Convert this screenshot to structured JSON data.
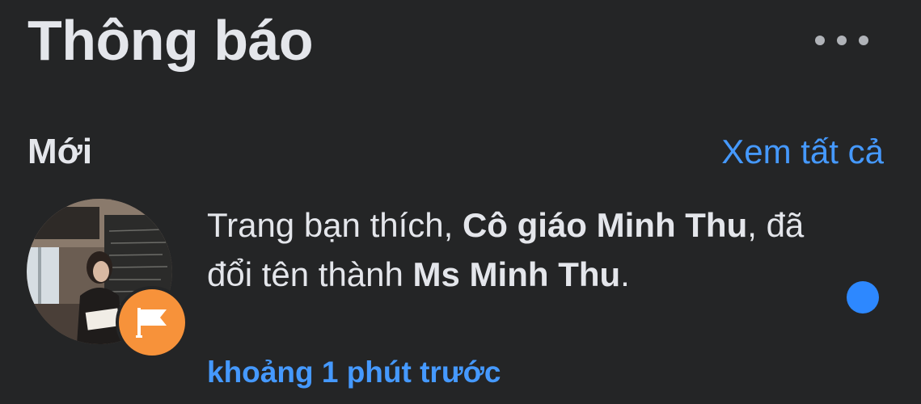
{
  "header": {
    "title": "Thông báo",
    "more_icon": "more-horizontal-icon"
  },
  "section": {
    "label": "Mới",
    "see_all": "Xem tất cả"
  },
  "notification": {
    "text_1": "Trang bạn thích, ",
    "bold_1": "Cô giáo Minh Thu",
    "text_2": ", đã đổi tên thành ",
    "bold_2": "Ms Minh Thu",
    "text_3": ".",
    "time": "khoảng 1 phút trước",
    "badge_icon": "flag-icon",
    "unread": true
  },
  "colors": {
    "background": "#242526",
    "text_primary": "#e4e6eb",
    "accent_blue": "#4599ff",
    "unread_dot": "#2d88ff",
    "badge_orange": "#f7923a"
  }
}
